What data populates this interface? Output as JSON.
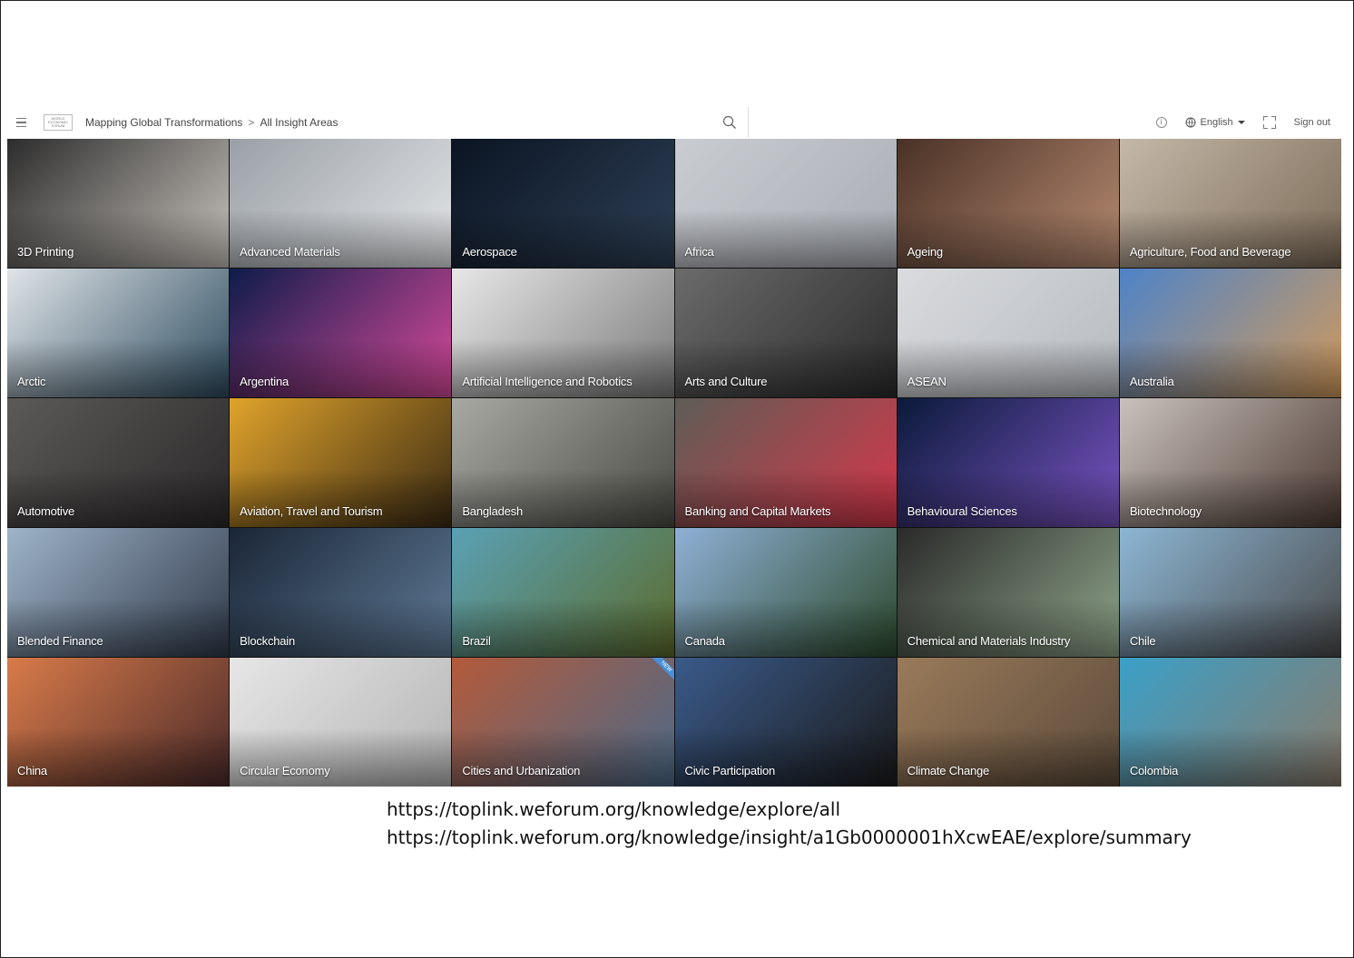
{
  "header": {
    "menu_icon": "hamburger-icon",
    "logo_text": "WORLD ECONOMIC FORUM",
    "breadcrumb": [
      "Mapping Global Transformations",
      "All Insight Areas"
    ],
    "breadcrumb_separator": ">",
    "search_icon": "search-icon",
    "info_icon": "info-icon",
    "language": "English",
    "language_icon": "globe-icon",
    "fullscreen_icon": "fullscreen-icon",
    "sign_out": "Sign out"
  },
  "tiles": [
    {
      "label": "3D Printing",
      "colors": [
        "#2c2c2c",
        "#c9c4bd"
      ]
    },
    {
      "label": "Advanced Materials",
      "colors": [
        "#9aa0a6",
        "#e4e6e8"
      ]
    },
    {
      "label": "Aerospace",
      "colors": [
        "#0a1422",
        "#2e4056"
      ]
    },
    {
      "label": "Africa",
      "colors": [
        "#c9ccd1",
        "#a9adb3"
      ]
    },
    {
      "label": "Ageing",
      "colors": [
        "#4a3126",
        "#b88c72"
      ]
    },
    {
      "label": "Agriculture, Food and Beverage",
      "colors": [
        "#c4b8a8",
        "#7b6a57"
      ]
    },
    {
      "label": "Arctic",
      "colors": [
        "#dfe4e8",
        "#2d4b5e"
      ]
    },
    {
      "label": "Argentina",
      "colors": [
        "#0e1c4a",
        "#d84a9b"
      ]
    },
    {
      "label": "Artificial Intelligence and Robotics",
      "colors": [
        "#e7e7e7",
        "#7a7a7a"
      ]
    },
    {
      "label": "Arts and Culture",
      "colors": [
        "#6b6b6b",
        "#2a2a2a"
      ]
    },
    {
      "label": "ASEAN",
      "colors": [
        "#d9dbde",
        "#b6babf"
      ]
    },
    {
      "label": "Australia",
      "colors": [
        "#4e83c8",
        "#d29a5a"
      ]
    },
    {
      "label": "Automotive",
      "colors": [
        "#5c5a58",
        "#2a2828"
      ]
    },
    {
      "label": "Aviation, Travel and Tourism",
      "colors": [
        "#e0a32b",
        "#3b2b14"
      ]
    },
    {
      "label": "Bangladesh",
      "colors": [
        "#a9a9a3",
        "#4a4a44"
      ]
    },
    {
      "label": "Banking and Capital Markets",
      "colors": [
        "#5d5d55",
        "#d7364a"
      ]
    },
    {
      "label": "Behavioural Sciences",
      "colors": [
        "#0a1a3a",
        "#7a54c4"
      ]
    },
    {
      "label": "Biotechnology",
      "colors": [
        "#c9c2bc",
        "#4d3b33"
      ]
    },
    {
      "label": "Blended Finance",
      "colors": [
        "#9fb4c8",
        "#2f3a4a"
      ]
    },
    {
      "label": "Blockchain",
      "colors": [
        "#1a2636",
        "#5f7a96"
      ]
    },
    {
      "label": "Brazil",
      "colors": [
        "#5aa1b5",
        "#5b6b2c"
      ]
    },
    {
      "label": "Canada",
      "colors": [
        "#8fb0d6",
        "#2c4a2c"
      ]
    },
    {
      "label": "Chemical and Materials Industry",
      "colors": [
        "#2a2a2a",
        "#8fa68a"
      ]
    },
    {
      "label": "Chile",
      "colors": [
        "#8cb6d4",
        "#4a4a4a"
      ]
    },
    {
      "label": "China",
      "colors": [
        "#d97b4a",
        "#4a2a2a"
      ]
    },
    {
      "label": "Circular Economy",
      "colors": [
        "#e6e6e6",
        "#b4b4b4"
      ]
    },
    {
      "label": "Cities and Urbanization",
      "colors": [
        "#b45a3a",
        "#4a6a8a"
      ],
      "badge": "NEW"
    },
    {
      "label": "Civic Participation",
      "colors": [
        "#3a5a8a",
        "#1a1a1a"
      ]
    },
    {
      "label": "Climate Change",
      "colors": [
        "#9a7a5a",
        "#5a4a3a"
      ]
    },
    {
      "label": "Colombia",
      "colors": [
        "#3aa0c8",
        "#8a7a6a"
      ]
    }
  ],
  "urls": [
    "https://toplink.weforum.org/knowledge/explore/all",
    "https://toplink.weforum.org/knowledge/insight/a1Gb0000001hXcwEAE/explore/summary"
  ]
}
